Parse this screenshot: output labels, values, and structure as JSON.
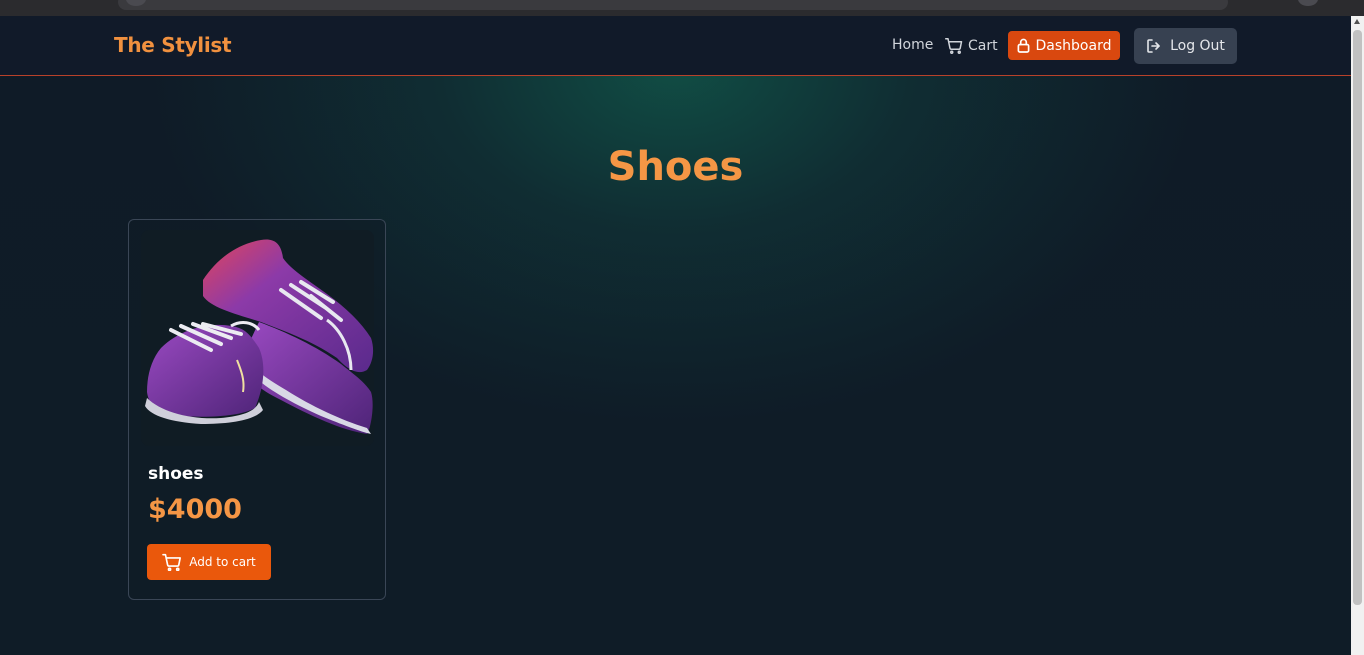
{
  "navbar": {
    "brand": "The Stylist",
    "links": {
      "home": "Home",
      "cart": "Cart"
    },
    "dashboard_label": "Dashboard",
    "logout_label": "Log Out"
  },
  "main": {
    "heading": "Shoes",
    "products": [
      {
        "title": "shoes",
        "price": "$4000",
        "add_to_cart_label": "Add to cart",
        "image_icon": "sneaker-image"
      }
    ]
  },
  "colors": {
    "accent": "#f59645",
    "brand": "#f1913f",
    "dashboard_button": "#d9480f",
    "add_button": "#ea580c",
    "logout_button": "#374151",
    "navbar_border": "#b8412a"
  },
  "icons": {
    "cart": "cart-icon",
    "lock": "lock-icon",
    "logout": "logout-icon"
  }
}
